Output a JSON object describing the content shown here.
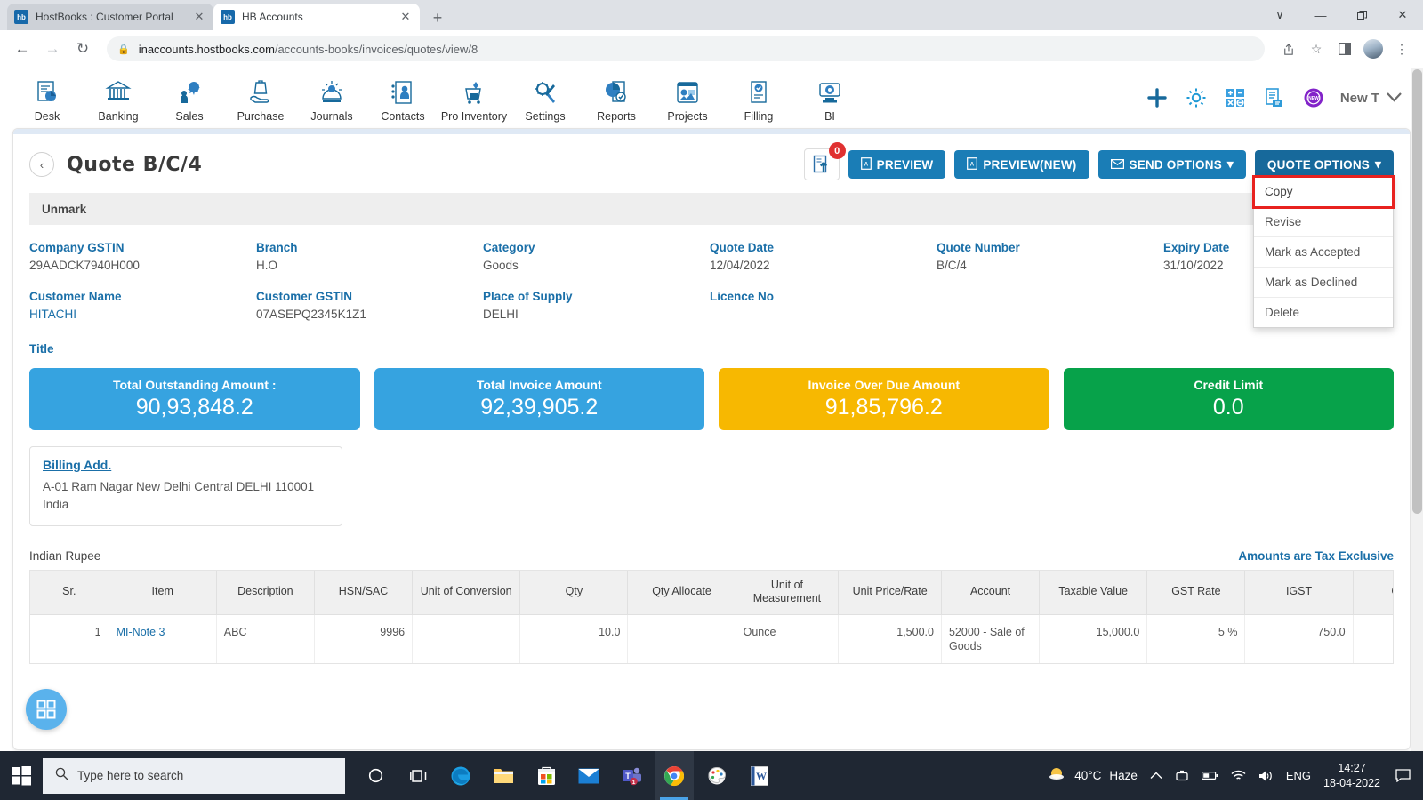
{
  "browser": {
    "tabs": [
      {
        "title": "HostBooks : Customer Portal",
        "favicon": "hb",
        "active": false
      },
      {
        "title": "HB Accounts",
        "favicon": "hb",
        "active": true
      }
    ],
    "new_tab_label": "+",
    "window_controls": {
      "minimize": "—",
      "maximize": "❐",
      "close": "✕",
      "tablist": "∨"
    },
    "url_secure": "inaccounts.hostbooks.com",
    "url_path": "/accounts-books/invoices/quotes/view/8",
    "back_label": "←",
    "forward_label": "→",
    "reload_label": "↻",
    "toolbar_icons": [
      "share-icon",
      "bookmark-star-icon",
      "sidepanel-icon",
      "profile-avatar",
      "chrome-menu-icon"
    ]
  },
  "appnav": {
    "items": [
      {
        "label": "Desk",
        "icon": "desk-icon"
      },
      {
        "label": "Banking",
        "icon": "bank-icon"
      },
      {
        "label": "Sales",
        "icon": "sales-icon"
      },
      {
        "label": "Purchase",
        "icon": "purchase-icon"
      },
      {
        "label": "Journals",
        "icon": "journals-icon"
      },
      {
        "label": "Contacts",
        "icon": "contacts-icon"
      },
      {
        "label": "Pro Inventory",
        "icon": "inventory-icon"
      },
      {
        "label": "Settings",
        "icon": "settings-icon"
      },
      {
        "label": "Reports",
        "icon": "reports-icon"
      },
      {
        "label": "Projects",
        "icon": "projects-icon"
      },
      {
        "label": "Filling",
        "icon": "filling-icon"
      },
      {
        "label": "BI",
        "icon": "bi-icon"
      }
    ],
    "right_icons": [
      "plus-icon",
      "gear-icon",
      "calculator-icon",
      "notes-icon",
      "new-badge-icon"
    ],
    "user_label": "New T",
    "user_caret": "⌄"
  },
  "quote": {
    "back_icon": "‹",
    "title": "Quote B/C/4",
    "upload_badge": "0",
    "buttons": {
      "preview": "PREVIEW",
      "preview_new": "PREVIEW(NEW)",
      "send_options": "SEND OPTIONS",
      "quote_options": "QUOTE OPTIONS",
      "caret": "▾"
    },
    "dropdown": {
      "items": [
        {
          "label": "Copy",
          "highlighted": true
        },
        {
          "label": "Revise",
          "highlighted": false
        },
        {
          "label": "Mark as Accepted",
          "highlighted": false
        },
        {
          "label": "Mark as Declined",
          "highlighted": false
        },
        {
          "label": "Delete",
          "highlighted": false
        }
      ],
      "highlight_color": "#e8221f"
    },
    "status_bar": "Unmark",
    "fields_row1": [
      {
        "label": "Company GSTIN",
        "value": "29AADCK7940H000"
      },
      {
        "label": "Branch",
        "value": "H.O"
      },
      {
        "label": "Category",
        "value": "Goods"
      },
      {
        "label": "Quote Date",
        "value": "12/04/2022"
      },
      {
        "label": "Quote Number",
        "value": "B/C/4"
      },
      {
        "label": "Expiry Date",
        "value": "31/10/2022"
      }
    ],
    "fields_row2": [
      {
        "label": "Customer Name",
        "value": "HITACHI",
        "link": true
      },
      {
        "label": "Customer GSTIN",
        "value": "07ASEPQ2345K1Z1",
        "link": false
      },
      {
        "label": "Place of Supply",
        "value": "DELHI",
        "link": false
      },
      {
        "label": "Licence No",
        "value": "",
        "link": false
      }
    ],
    "title_label": "Title",
    "cards": [
      {
        "label": "Total Outstanding Amount :",
        "value": "90,93,848.2",
        "color": "#36a3e0"
      },
      {
        "label": "Total Invoice Amount",
        "value": "92,39,905.2",
        "color": "#36a3e0"
      },
      {
        "label": "Invoice Over Due Amount",
        "value": "91,85,796.2",
        "color": "#f7b801"
      },
      {
        "label": "Credit Limit",
        "value": "0.0",
        "color": "#07a24a"
      }
    ],
    "billing": {
      "title": "Billing Add.",
      "line1": "A-01 Ram Nagar New Delhi Central DELHI 110001",
      "line2": "India"
    },
    "currency": "Indian Rupee",
    "tax_note": "Amounts are Tax Exclusive",
    "table": {
      "columns": [
        "Sr.",
        "Item",
        "Description",
        "HSN/SAC",
        "Unit of Conversion",
        "Qty",
        "Qty Allocate",
        "Unit of Measurement",
        "Unit Price/Rate",
        "Account",
        "Taxable Value",
        "GST Rate",
        "IGST",
        "Cess(fla"
      ],
      "rows": [
        {
          "sr": "1",
          "item": "MI-Note 3",
          "description": "ABC",
          "hsn": "9996",
          "unit_conversion": "",
          "qty": "10.0",
          "qty_allocate": "",
          "uom": "Ounce",
          "unit_price": "1,500.0",
          "account": "52000 - Sale of Goods",
          "taxable_value": "15,000.0",
          "gst_rate": "5 %",
          "igst": "750.0",
          "cess": ""
        }
      ]
    },
    "fab_icon": "grid-apps-icon"
  },
  "taskbar": {
    "start_icon": "windows-start-icon",
    "search_placeholder": "Type here to search",
    "search_icon": "search-icon",
    "apps": [
      {
        "name": "cortana-icon",
        "active": false
      },
      {
        "name": "task-view-icon",
        "active": false
      },
      {
        "name": "edge-icon",
        "active": false
      },
      {
        "name": "file-explorer-icon",
        "active": false
      },
      {
        "name": "microsoft-store-icon",
        "active": false
      },
      {
        "name": "mail-icon",
        "active": false
      },
      {
        "name": "teams-icon",
        "active": false,
        "badge": "1"
      },
      {
        "name": "chrome-icon",
        "active": true
      },
      {
        "name": "paint-icon",
        "active": false
      },
      {
        "name": "word-icon",
        "active": false
      }
    ],
    "weather_temp": "40°C",
    "weather_desc": "Haze",
    "tray_icons": [
      "chevron-up-icon",
      "onedrive-icon",
      "battery-icon",
      "wifi-icon",
      "volume-icon"
    ],
    "language": "ENG",
    "time": "14:27",
    "date": "18-04-2022",
    "notification_icon": "notification-icon"
  }
}
